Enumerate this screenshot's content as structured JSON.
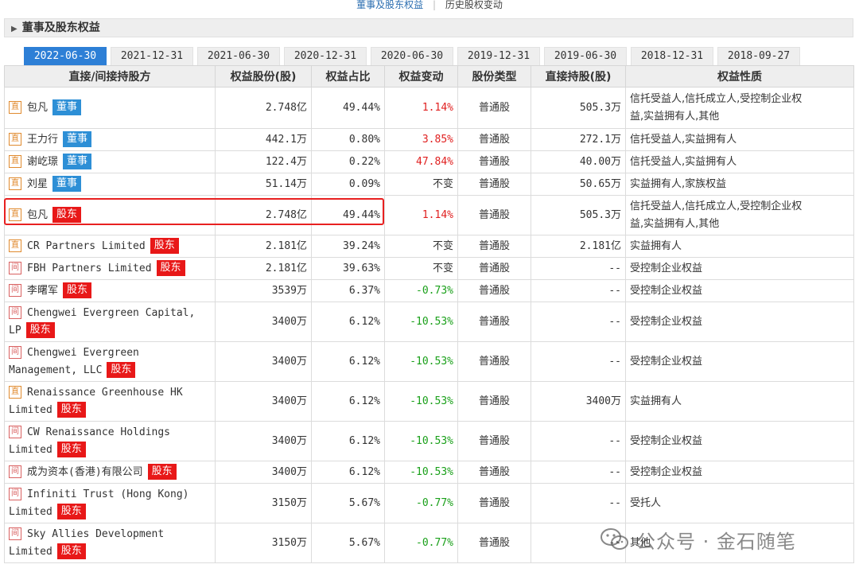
{
  "nav": {
    "link1": "董事及股东权益",
    "link2": "历史股权变动"
  },
  "section_title": "董事及股东权益",
  "tabs": [
    "2022-06-30",
    "2021-12-31",
    "2021-06-30",
    "2020-12-31",
    "2020-06-30",
    "2019-12-31",
    "2019-06-30",
    "2018-12-31",
    "2018-09-27"
  ],
  "active_tab": 0,
  "columns": [
    "直接/间接持股方",
    "权益股份(股)",
    "权益占比",
    "权益变动",
    "股份类型",
    "直接持股(股)",
    "权益性质"
  ],
  "rows": [
    {
      "type": "直",
      "name_lines": [
        "包凡"
      ],
      "role": "董事",
      "shares": "2.748亿",
      "pct": "49.44%",
      "change": "1.14%",
      "dir": "up",
      "stype": "普通股",
      "direct": "505.3万",
      "nature_lines": [
        "信托受益人,信托成立人,受控制企业权",
        "益,实益拥有人,其他"
      ],
      "h": 52
    },
    {
      "type": "直",
      "name_lines": [
        "王力行"
      ],
      "role": "董事",
      "shares": "442.1万",
      "pct": "0.80%",
      "change": "3.85%",
      "dir": "up",
      "stype": "普通股",
      "direct": "272.1万",
      "nature_lines": [
        "信托受益人,实益拥有人"
      ],
      "h": 28
    },
    {
      "type": "直",
      "name_lines": [
        "谢屹璟"
      ],
      "role": "董事",
      "shares": "122.4万",
      "pct": "0.22%",
      "change": "47.84%",
      "dir": "up",
      "stype": "普通股",
      "direct": "40.00万",
      "nature_lines": [
        "信托受益人,实益拥有人"
      ],
      "h": 28
    },
    {
      "type": "直",
      "name_lines": [
        "刘星"
      ],
      "role": "董事",
      "shares": "51.14万",
      "pct": "0.09%",
      "change": "不变",
      "dir": "same",
      "stype": "普通股",
      "direct": "50.65万",
      "nature_lines": [
        "实益拥有人,家族权益"
      ],
      "h": 28
    },
    {
      "type": "直",
      "name_lines": [
        "包凡"
      ],
      "role": "股东",
      "shares": "2.748亿",
      "pct": "49.44%",
      "change": "1.14%",
      "dir": "up",
      "stype": "普通股",
      "direct": "505.3万",
      "nature_lines": [
        "信托受益人,信托成立人,受控制企业权",
        "益,实益拥有人,其他"
      ],
      "h": 50
    },
    {
      "type": "直",
      "name_lines": [
        "CR Partners Limited"
      ],
      "role": "股东",
      "shares": "2.181亿",
      "pct": "39.24%",
      "change": "不变",
      "dir": "same",
      "stype": "普通股",
      "direct": "2.181亿",
      "nature_lines": [
        "实益拥有人"
      ],
      "h": 28
    },
    {
      "type": "间",
      "name_lines": [
        "FBH Partners Limited"
      ],
      "role": "股东",
      "shares": "2.181亿",
      "pct": "39.63%",
      "change": "不变",
      "dir": "same",
      "stype": "普通股",
      "direct": "--",
      "nature_lines": [
        "受控制企业权益"
      ],
      "h": 28
    },
    {
      "type": "间",
      "name_lines": [
        "李曙军"
      ],
      "role": "股东",
      "shares": "3539万",
      "pct": "6.37%",
      "change": "-0.73%",
      "dir": "down",
      "stype": "普通股",
      "direct": "--",
      "nature_lines": [
        "受控制企业权益"
      ],
      "h": 28
    },
    {
      "type": "间",
      "name_lines": [
        "Chengwei Evergreen Capital,",
        "LP"
      ],
      "role": "股东",
      "shares": "3400万",
      "pct": "6.12%",
      "change": "-10.53%",
      "dir": "down",
      "stype": "普通股",
      "direct": "--",
      "nature_lines": [
        "受控制企业权益"
      ],
      "h": 50
    },
    {
      "type": "间",
      "name_lines": [
        "Chengwei Evergreen",
        "Management, LLC"
      ],
      "role": "股东",
      "shares": "3400万",
      "pct": "6.12%",
      "change": "-10.53%",
      "dir": "down",
      "stype": "普通股",
      "direct": "--",
      "nature_lines": [
        "受控制企业权益"
      ],
      "h": 50
    },
    {
      "type": "直",
      "name_lines": [
        "Renaissance Greenhouse HK",
        "Limited"
      ],
      "role": "股东",
      "shares": "3400万",
      "pct": "6.12%",
      "change": "-10.53%",
      "dir": "down",
      "stype": "普通股",
      "direct": "3400万",
      "nature_lines": [
        "实益拥有人"
      ],
      "h": 50
    },
    {
      "type": "间",
      "name_lines": [
        "CW Renaissance Holdings",
        "Limited"
      ],
      "role": "股东",
      "shares": "3400万",
      "pct": "6.12%",
      "change": "-10.53%",
      "dir": "down",
      "stype": "普通股",
      "direct": "--",
      "nature_lines": [
        "受控制企业权益"
      ],
      "h": 50
    },
    {
      "type": "间",
      "name_lines": [
        "成为资本(香港)有限公司"
      ],
      "role": "股东",
      "shares": "3400万",
      "pct": "6.12%",
      "change": "-10.53%",
      "dir": "down",
      "stype": "普通股",
      "direct": "--",
      "nature_lines": [
        "受控制企业权益"
      ],
      "h": 28
    },
    {
      "type": "间",
      "name_lines": [
        "Infiniti Trust (Hong Kong)",
        "Limited"
      ],
      "role": "股东",
      "shares": "3150万",
      "pct": "5.67%",
      "change": "-0.77%",
      "dir": "down",
      "stype": "普通股",
      "direct": "--",
      "nature_lines": [
        "受托人"
      ],
      "h": 50
    },
    {
      "type": "间",
      "name_lines": [
        "Sky Allies Development",
        "Limited"
      ],
      "role": "股东",
      "shares": "3150万",
      "pct": "5.67%",
      "change": "-0.77%",
      "dir": "down",
      "stype": "普通股",
      "direct": "--",
      "nature_lines": [
        "其他"
      ],
      "h": 50
    }
  ],
  "watermark": "公众号 · 金石随笔",
  "colors": {
    "accent": "#2d7fd6",
    "director_badge": "#2d8fd6",
    "holder_badge": "#e81818",
    "up": "#e02020",
    "down": "#1aa01a",
    "highlight": "#e82020"
  }
}
